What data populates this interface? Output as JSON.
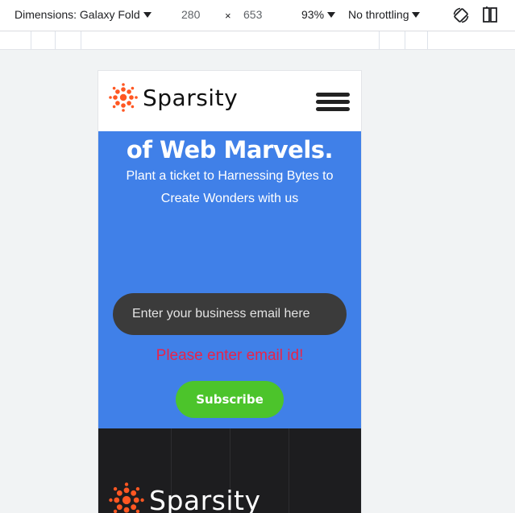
{
  "devtools": {
    "dimensions_label": "Dimensions: Galaxy Fold",
    "width": "280",
    "times": "×",
    "height": "653",
    "zoom": "93%",
    "throttling": "No throttling",
    "icons": [
      "rotate-icon",
      "dual-screen-icon"
    ]
  },
  "site": {
    "brand": "Sparsity",
    "brand_color": "#ff5722",
    "hero": {
      "title": "of Web Marvels.",
      "subtitle": "Plant a ticket to Harnessing Bytes to Create Wonders with us",
      "background": "#4080e8"
    },
    "form": {
      "email_placeholder": "Enter your business email here",
      "email_value": "",
      "error": "Please enter email id!",
      "subscribe_label": "Subscribe"
    },
    "footer": {
      "brand": "Sparsity"
    }
  }
}
